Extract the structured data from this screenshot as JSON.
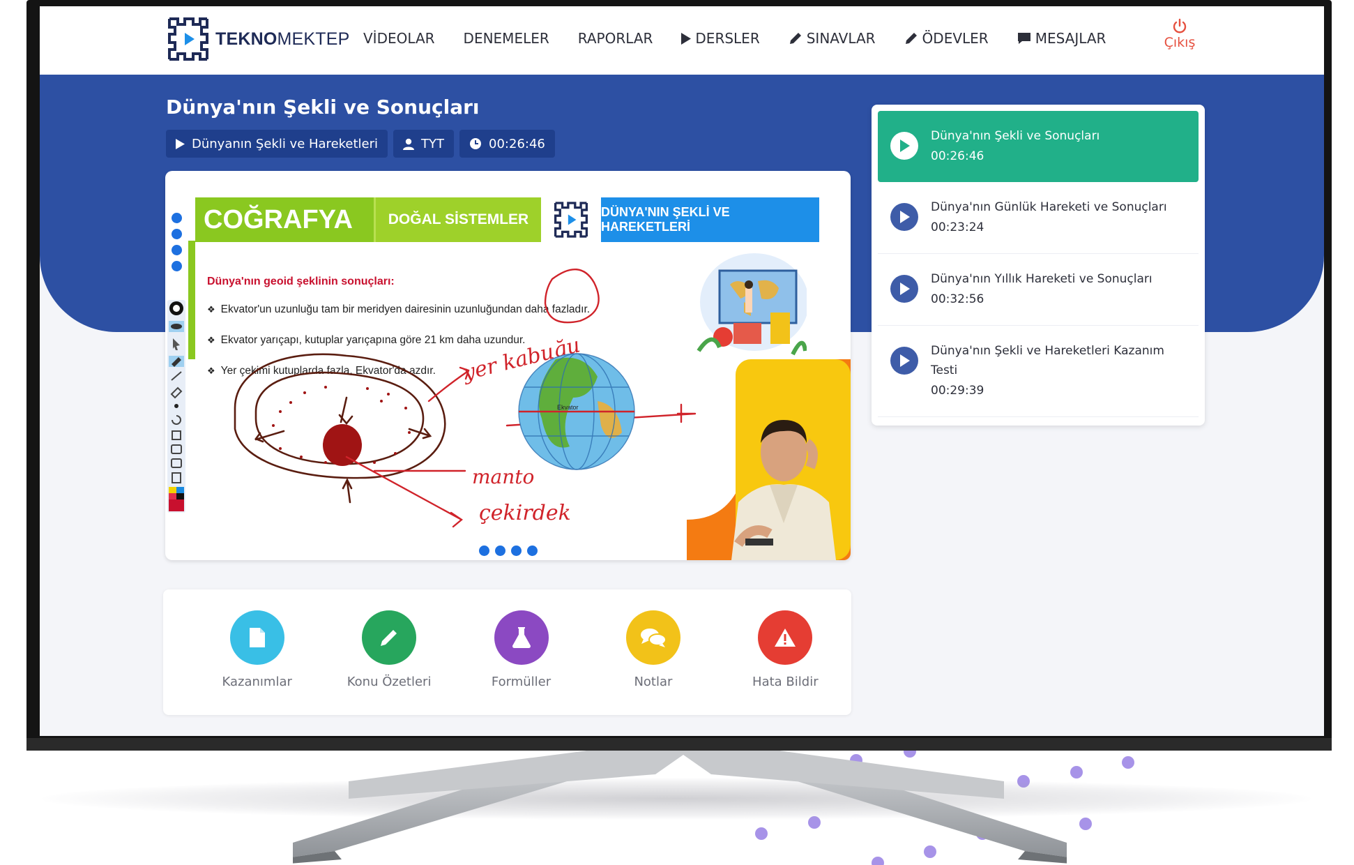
{
  "brand": {
    "logo_bold": "TEKNO",
    "logo_rest": "MEKTEP"
  },
  "nav": {
    "items": [
      {
        "label": "VİDEOLAR",
        "icon": ""
      },
      {
        "label": "DENEMELER",
        "icon": ""
      },
      {
        "label": "RAPORLAR",
        "icon": ""
      },
      {
        "label": "DERSLER",
        "icon": "play-icon"
      },
      {
        "label": "SINAVLAR",
        "icon": "pencil-icon"
      },
      {
        "label": "ÖDEVLER",
        "icon": "pencil-icon"
      },
      {
        "label": "MESAJLAR",
        "icon": "message-icon"
      }
    ],
    "logout_label": "Çıkış",
    "logout_color": "#e6503f"
  },
  "lesson": {
    "title": "Dünya'nın Şekli ve Sonuçları",
    "unit": "Dünyanın Şekli ve Hareketleri",
    "level": "TYT",
    "duration": "00:26:46"
  },
  "slide": {
    "subject": "COĞRAFYA",
    "section": "DOĞAL SİSTEMLER",
    "topic": "DÜNYA'NIN ŞEKLİ VE HAREKETLERİ",
    "subtitle": "Dünya'nın geoid şeklinin sonuçları:",
    "bullets": [
      "Ekvator'un uzunluğu tam bir meridyen dairesinin uzunluğundan daha fazladır.",
      "Ekvator yarıçapı, kutuplar yarıçapına göre 21 km daha uzundur.",
      "Yer çekimi kutuplarda fazla, Ekvator'da azdır."
    ],
    "handwriting": [
      "yer kabuğu",
      "manto",
      "çekirdek"
    ],
    "globe_label": "Ekvator"
  },
  "playlist": [
    {
      "title": "Dünya'nın Şekli ve Sonuçları",
      "time": "00:26:46",
      "active": true
    },
    {
      "title": "Dünya'nın Günlük Hareketi ve Sonuçları",
      "time": "00:23:24",
      "active": false
    },
    {
      "title": "Dünya'nın Yıllık Hareketi ve Sonuçları",
      "time": "00:32:56",
      "active": false
    },
    {
      "title": "Dünya'nın Şekli ve Hareketleri Kazanım Testi",
      "time": "00:29:39",
      "active": false
    }
  ],
  "resources": [
    {
      "label": "Kazanımlar",
      "icon": "document-icon",
      "color": "#39bfe6"
    },
    {
      "label": "Konu Özetleri",
      "icon": "pencil-icon",
      "color": "#27a65d"
    },
    {
      "label": "Formüller",
      "icon": "flask-icon",
      "color": "#8b49c2"
    },
    {
      "label": "Notlar",
      "icon": "chat-icon",
      "color": "#f2c219"
    },
    {
      "label": "Hata Bildir",
      "icon": "warning-icon",
      "color": "#e53d33"
    }
  ],
  "colors": {
    "hero_blue": "#2d50a3",
    "active_green": "#21b089",
    "slide_green": "#8ac820",
    "slide_blue": "#1d8fe8"
  }
}
